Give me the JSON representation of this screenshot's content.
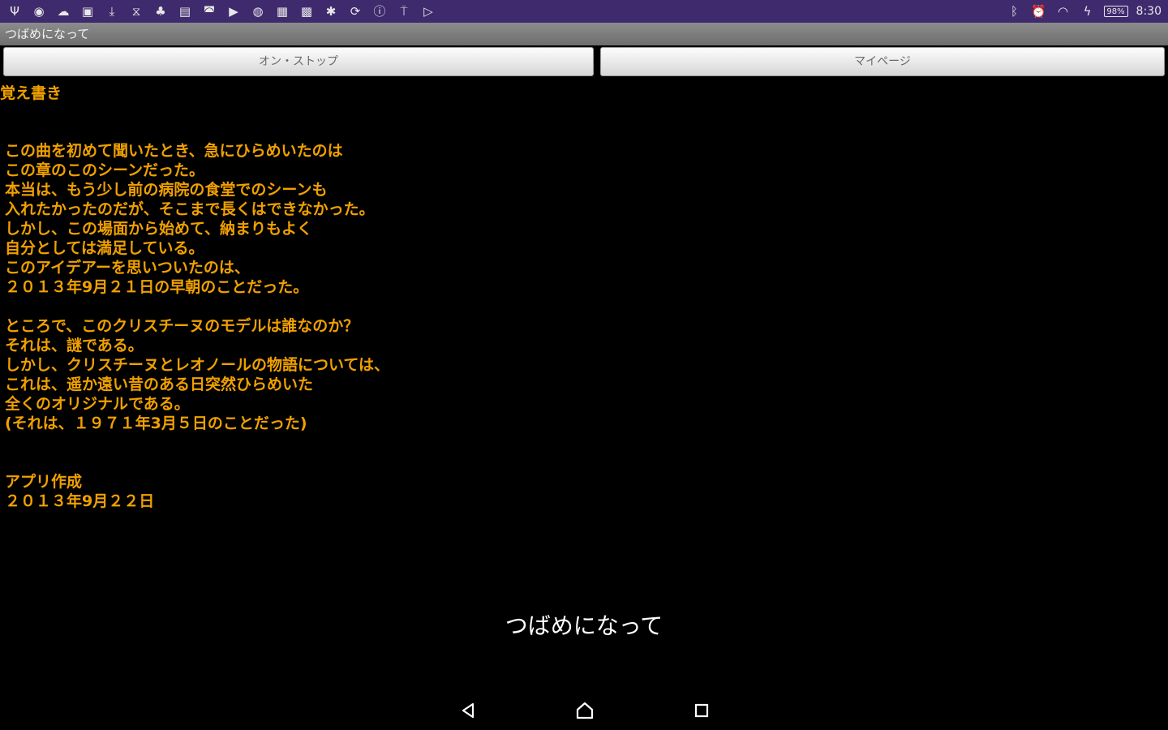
{
  "status_bar": {
    "background": "#3f2a6e",
    "left_icons": [
      {
        "name": "usb-icon",
        "glyph": "Ψ"
      },
      {
        "name": "app-notification-icon",
        "glyph": "◉"
      },
      {
        "name": "cloud-icon",
        "glyph": "☁"
      },
      {
        "name": "screenshot-icon",
        "glyph": "▣"
      },
      {
        "name": "download-icon",
        "glyph": "⤓"
      },
      {
        "name": "timer-icon",
        "glyph": "⧖"
      },
      {
        "name": "android-icon",
        "glyph": "♣"
      },
      {
        "name": "keyboard-icon",
        "glyph": "▤"
      },
      {
        "name": "gamepad-icon",
        "glyph": "◚"
      },
      {
        "name": "video-icon",
        "glyph": "▶"
      },
      {
        "name": "globe-icon",
        "glyph": "◍"
      },
      {
        "name": "image-icon",
        "glyph": "▦"
      },
      {
        "name": "photo-icon",
        "glyph": "▩"
      },
      {
        "name": "bulb-icon",
        "glyph": "✱"
      },
      {
        "name": "sync-icon",
        "glyph": "⟳"
      },
      {
        "name": "info-icon",
        "glyph": "ⓘ"
      },
      {
        "name": "pin-icon",
        "glyph": "⍑"
      },
      {
        "name": "play-store-icon",
        "glyph": "▷"
      }
    ],
    "right_icons": [
      {
        "name": "bluetooth-icon",
        "glyph": "ᛒ"
      },
      {
        "name": "alarm-icon",
        "glyph": "⏰"
      },
      {
        "name": "wifi-icon",
        "glyph": "◠"
      },
      {
        "name": "charging-icon",
        "glyph": "ϟ"
      }
    ],
    "battery": "98%",
    "time": "8:30"
  },
  "app": {
    "title": "つばめになって"
  },
  "buttons": {
    "left_label": "オン・ストップ",
    "right_label": "マイページ"
  },
  "content": {
    "heading": "覚え書き",
    "body": "この曲を初めて聞いたとき、急にひらめいたのは\nこの章のこのシーンだった。\n本当は、もう少し前の病院の食堂でのシーンも\n入れたかったのだが、そこまで長くはできなかった。\nしかし、この場面から始めて、納まりもよく\n自分としては満足している。\nこのアイデアーを思いついたのは、\n２０１３年9月２１日の早朝のことだった。\n\nところで、このクリスチーヌのモデルは誰なのか？\nそれは、謎である。\nしかし、クリスチーヌとレオノールの物語については、\nこれは、遥か遠い昔のある日突然ひらめいた\n全くのオリジナルである。\n(それは、１９７１年3月５日のことだった)\n\n\nアプリ作成\n２０１３年9月２２日"
  },
  "center_label": "つばめになって",
  "colors": {
    "text_accent": "#f0a000",
    "background": "#000000"
  }
}
